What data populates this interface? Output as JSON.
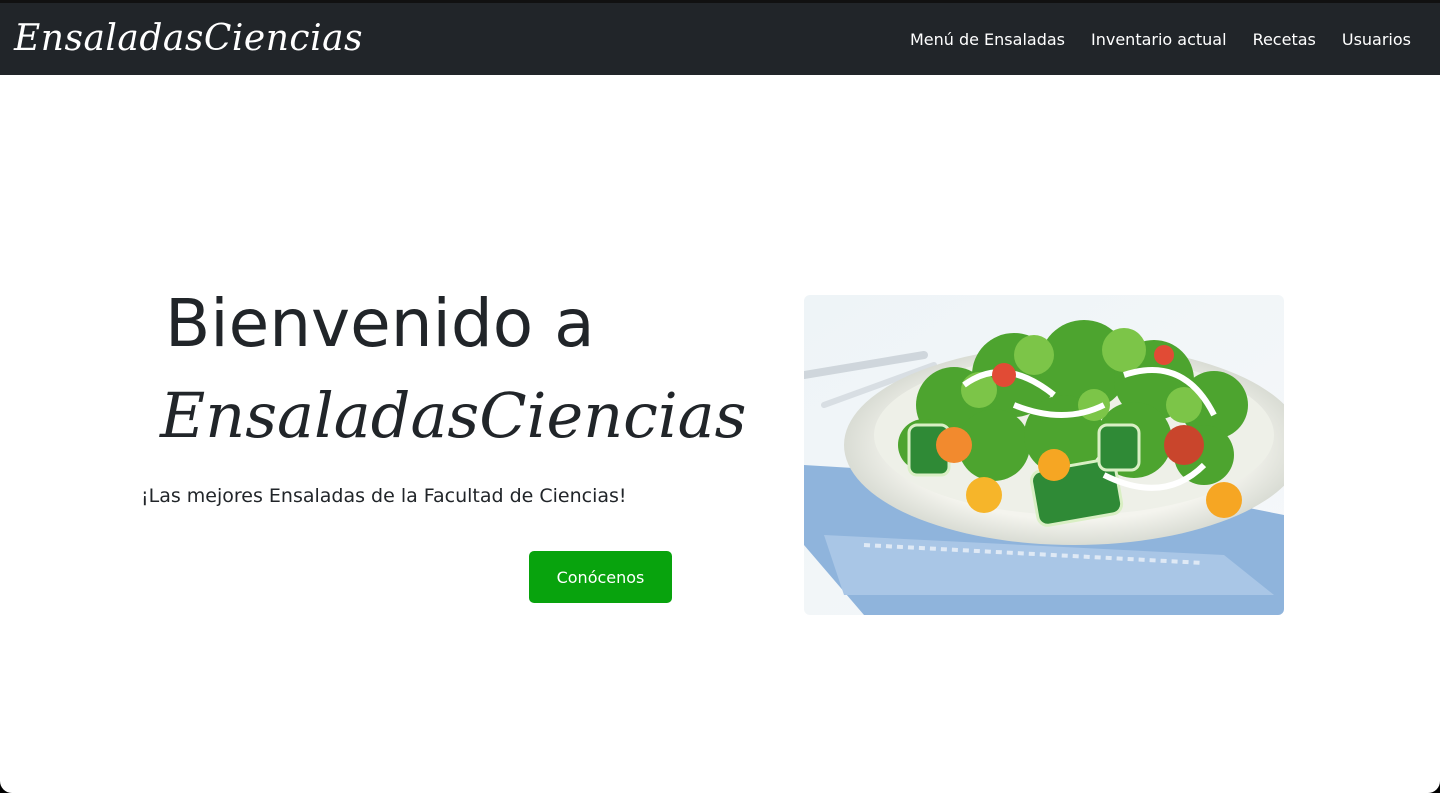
{
  "navbar": {
    "brand": "EnsaladasCiencias",
    "links": [
      "Menú de Ensaladas",
      "Inventario actual",
      "Recetas",
      "Usuarios"
    ]
  },
  "hero": {
    "title": "Bienvenido a",
    "brand": "EnsaladasCiencias",
    "subtitle": "¡Las mejores Ensaladas de la Facultad de Ciencias!",
    "cta_label": "Conócenos"
  },
  "colors": {
    "navbar_bg": "#212529",
    "cta_bg": "#08a30d",
    "text": "#212529"
  }
}
